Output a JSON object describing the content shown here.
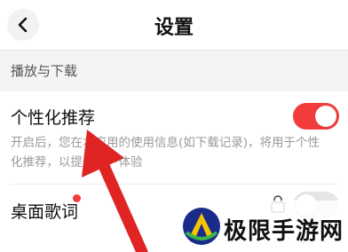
{
  "header": {
    "title": "设置",
    "back_icon": "chevron-left-icon"
  },
  "section": {
    "label": "播放与下载"
  },
  "settings": {
    "personalized": {
      "label": "个性化推荐",
      "description": "开启后，您在本应用的使用信息(如下载记录)，将用于个性化推荐，以提升用户体验",
      "enabled": true
    },
    "desktop_lyrics": {
      "label": "桌面歌词",
      "has_badge": true,
      "locked": true,
      "enabled": false
    }
  },
  "colors": {
    "accent": "#f23c3c",
    "toggle_off": "#e6e6e6",
    "section_bg": "#f4f4f4",
    "annotation_arrow": "#e02424"
  },
  "watermark": {
    "text": "极限手游网"
  }
}
